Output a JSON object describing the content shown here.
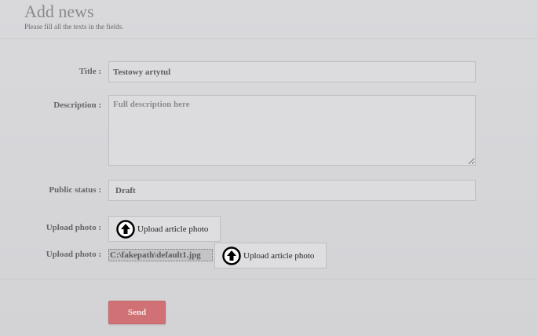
{
  "header": {
    "title": "Add news",
    "subtitle": "Please fill all the texts in the fields."
  },
  "form": {
    "title_label": "Title :",
    "title_value": "Testowy artytul",
    "description_label": "Description :",
    "description_placeholder": "Full description here",
    "status_label": "Public status :",
    "status_value": "Draft",
    "upload1_label": "Upload photo :",
    "upload1_button": "Upload article photo",
    "upload2_label": "Upload photo :",
    "upload2_path": "C:\\fakepath\\default1.jpg",
    "upload2_button": "Upload article photo",
    "send_label": "Send"
  },
  "icons": {
    "upload": "upload-arrow-circle-icon"
  },
  "colors": {
    "background": "#d6d6d9",
    "send_button": "#d07275"
  }
}
